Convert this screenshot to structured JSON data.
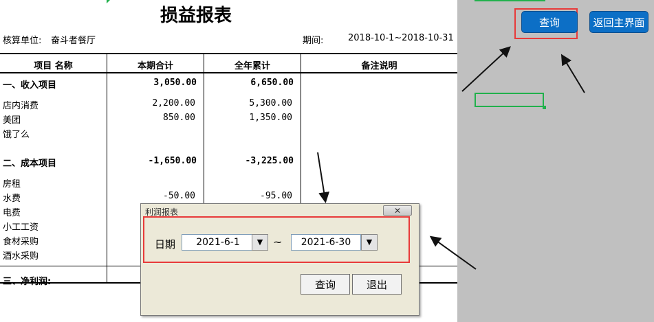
{
  "report": {
    "title": "损益报表",
    "unit_label": "核算单位:",
    "unit_value": "奋斗者餐厅",
    "period_label": "期间:",
    "period_value": "2018-10-1~2018-10-31",
    "columns": [
      "项目 名称",
      "本期合计",
      "全年累计",
      "备注说明"
    ],
    "rows": [
      {
        "label": "一、收入项目",
        "current": "3,050.00",
        "annual": "6,650.00",
        "bold": true
      },
      {
        "label": "店内消费",
        "current": "2,200.00",
        "annual": "5,300.00",
        "bold": false
      },
      {
        "label": "美团",
        "current": "850.00",
        "annual": "1,350.00",
        "bold": false
      },
      {
        "label": "饿了么",
        "current": "",
        "annual": "",
        "bold": false
      },
      {
        "label": "二、成本项目",
        "current": "-1,650.00",
        "annual": "-3,225.00",
        "bold": true
      },
      {
        "label": "房租",
        "current": "",
        "annual": "",
        "bold": false
      },
      {
        "label": "水费",
        "current": "-50.00",
        "annual": "-95.00",
        "bold": false
      },
      {
        "label": "电费",
        "current": "",
        "annual": "",
        "bold": false
      },
      {
        "label": "小工工资",
        "current": "",
        "annual": "",
        "bold": false
      },
      {
        "label": "食材采购",
        "current": "",
        "annual": "",
        "bold": false
      },
      {
        "label": "酒水采购",
        "current": "",
        "annual": "",
        "bold": false
      },
      {
        "label": "三、净利润:",
        "current": "",
        "annual": "",
        "bold": true
      }
    ]
  },
  "panel": {
    "query_button": "查询",
    "home_button": "返回主界面"
  },
  "dialog": {
    "title": "利润报表",
    "close_icon": "close-icon",
    "date_label": "日期",
    "start_date": "2021-6-1",
    "tilde": "~",
    "end_date": "2021-6-30",
    "query_button": "查询",
    "exit_button": "退出"
  },
  "colors": {
    "button_blue": "#0c6fc6",
    "highlight_red": "#e83a3a",
    "selection_green": "#21b14c",
    "panel_grey": "#c0c0c0"
  }
}
